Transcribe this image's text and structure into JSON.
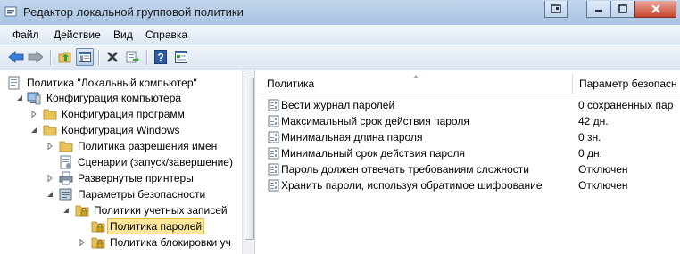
{
  "window": {
    "title": "Редактор локальной групповой политики"
  },
  "menu": {
    "items": [
      "Файл",
      "Действие",
      "Вид",
      "Справка"
    ]
  },
  "toolbar": {
    "buttons": [
      "back-icon",
      "forward-icon",
      "up-folder-icon",
      "show-hide-tree-icon",
      "delete-icon",
      "export-list-icon",
      "help-icon",
      "properties-icon"
    ]
  },
  "tree": {
    "nodes": [
      "Политика \"Локальный компьютер\"",
      "Конфигурация компьютера",
      "Конфигурация программ",
      "Конфигурация Windows",
      "Политика разрешения имен",
      "Сценарии (запуск/завершение)",
      "Развернутые принтеры",
      "Параметры безопасности",
      "Политики учетных записей",
      "Политика паролей",
      "Политика блокировки уч"
    ]
  },
  "list": {
    "columns": [
      "Политика",
      "Параметр безопасн"
    ],
    "rows": [
      {
        "name": "Вести журнал паролей",
        "value": "0 сохраненных пар"
      },
      {
        "name": "Максимальный срок действия пароля",
        "value": "42 дн."
      },
      {
        "name": "Минимальная длина пароля",
        "value": "0 зн."
      },
      {
        "name": "Минимальный срок действия пароля",
        "value": "0 дн."
      },
      {
        "name": "Пароль должен отвечать требованиям сложности",
        "value": "Отключен"
      },
      {
        "name": "Хранить пароли, используя обратимое шифрование",
        "value": "Отключен"
      }
    ]
  },
  "colors": {
    "title_bar": "#b9d1ea",
    "selection": "#ffe79a",
    "folder": "#e8c35a"
  }
}
